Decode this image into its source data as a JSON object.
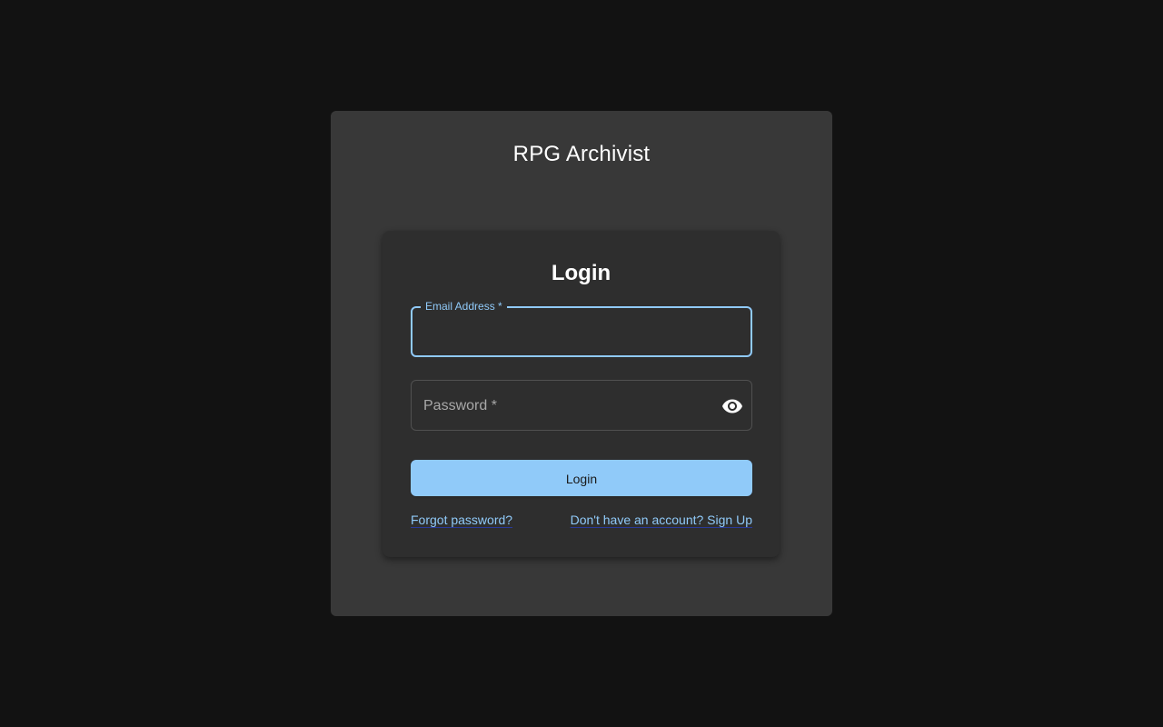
{
  "app": {
    "title": "RPG Archivist"
  },
  "login": {
    "heading": "Login",
    "email": {
      "label": "Email Address *",
      "value": ""
    },
    "password": {
      "placeholder": "Password *",
      "toggle_icon": "eye-icon"
    },
    "submit_label": "Login",
    "forgot_link": "Forgot password?",
    "signup_link": "Don't have an account? Sign Up"
  },
  "colors": {
    "background": "#121212",
    "outer_card": "#383838",
    "login_card": "#2e2e2e",
    "accent": "#90caf9"
  }
}
